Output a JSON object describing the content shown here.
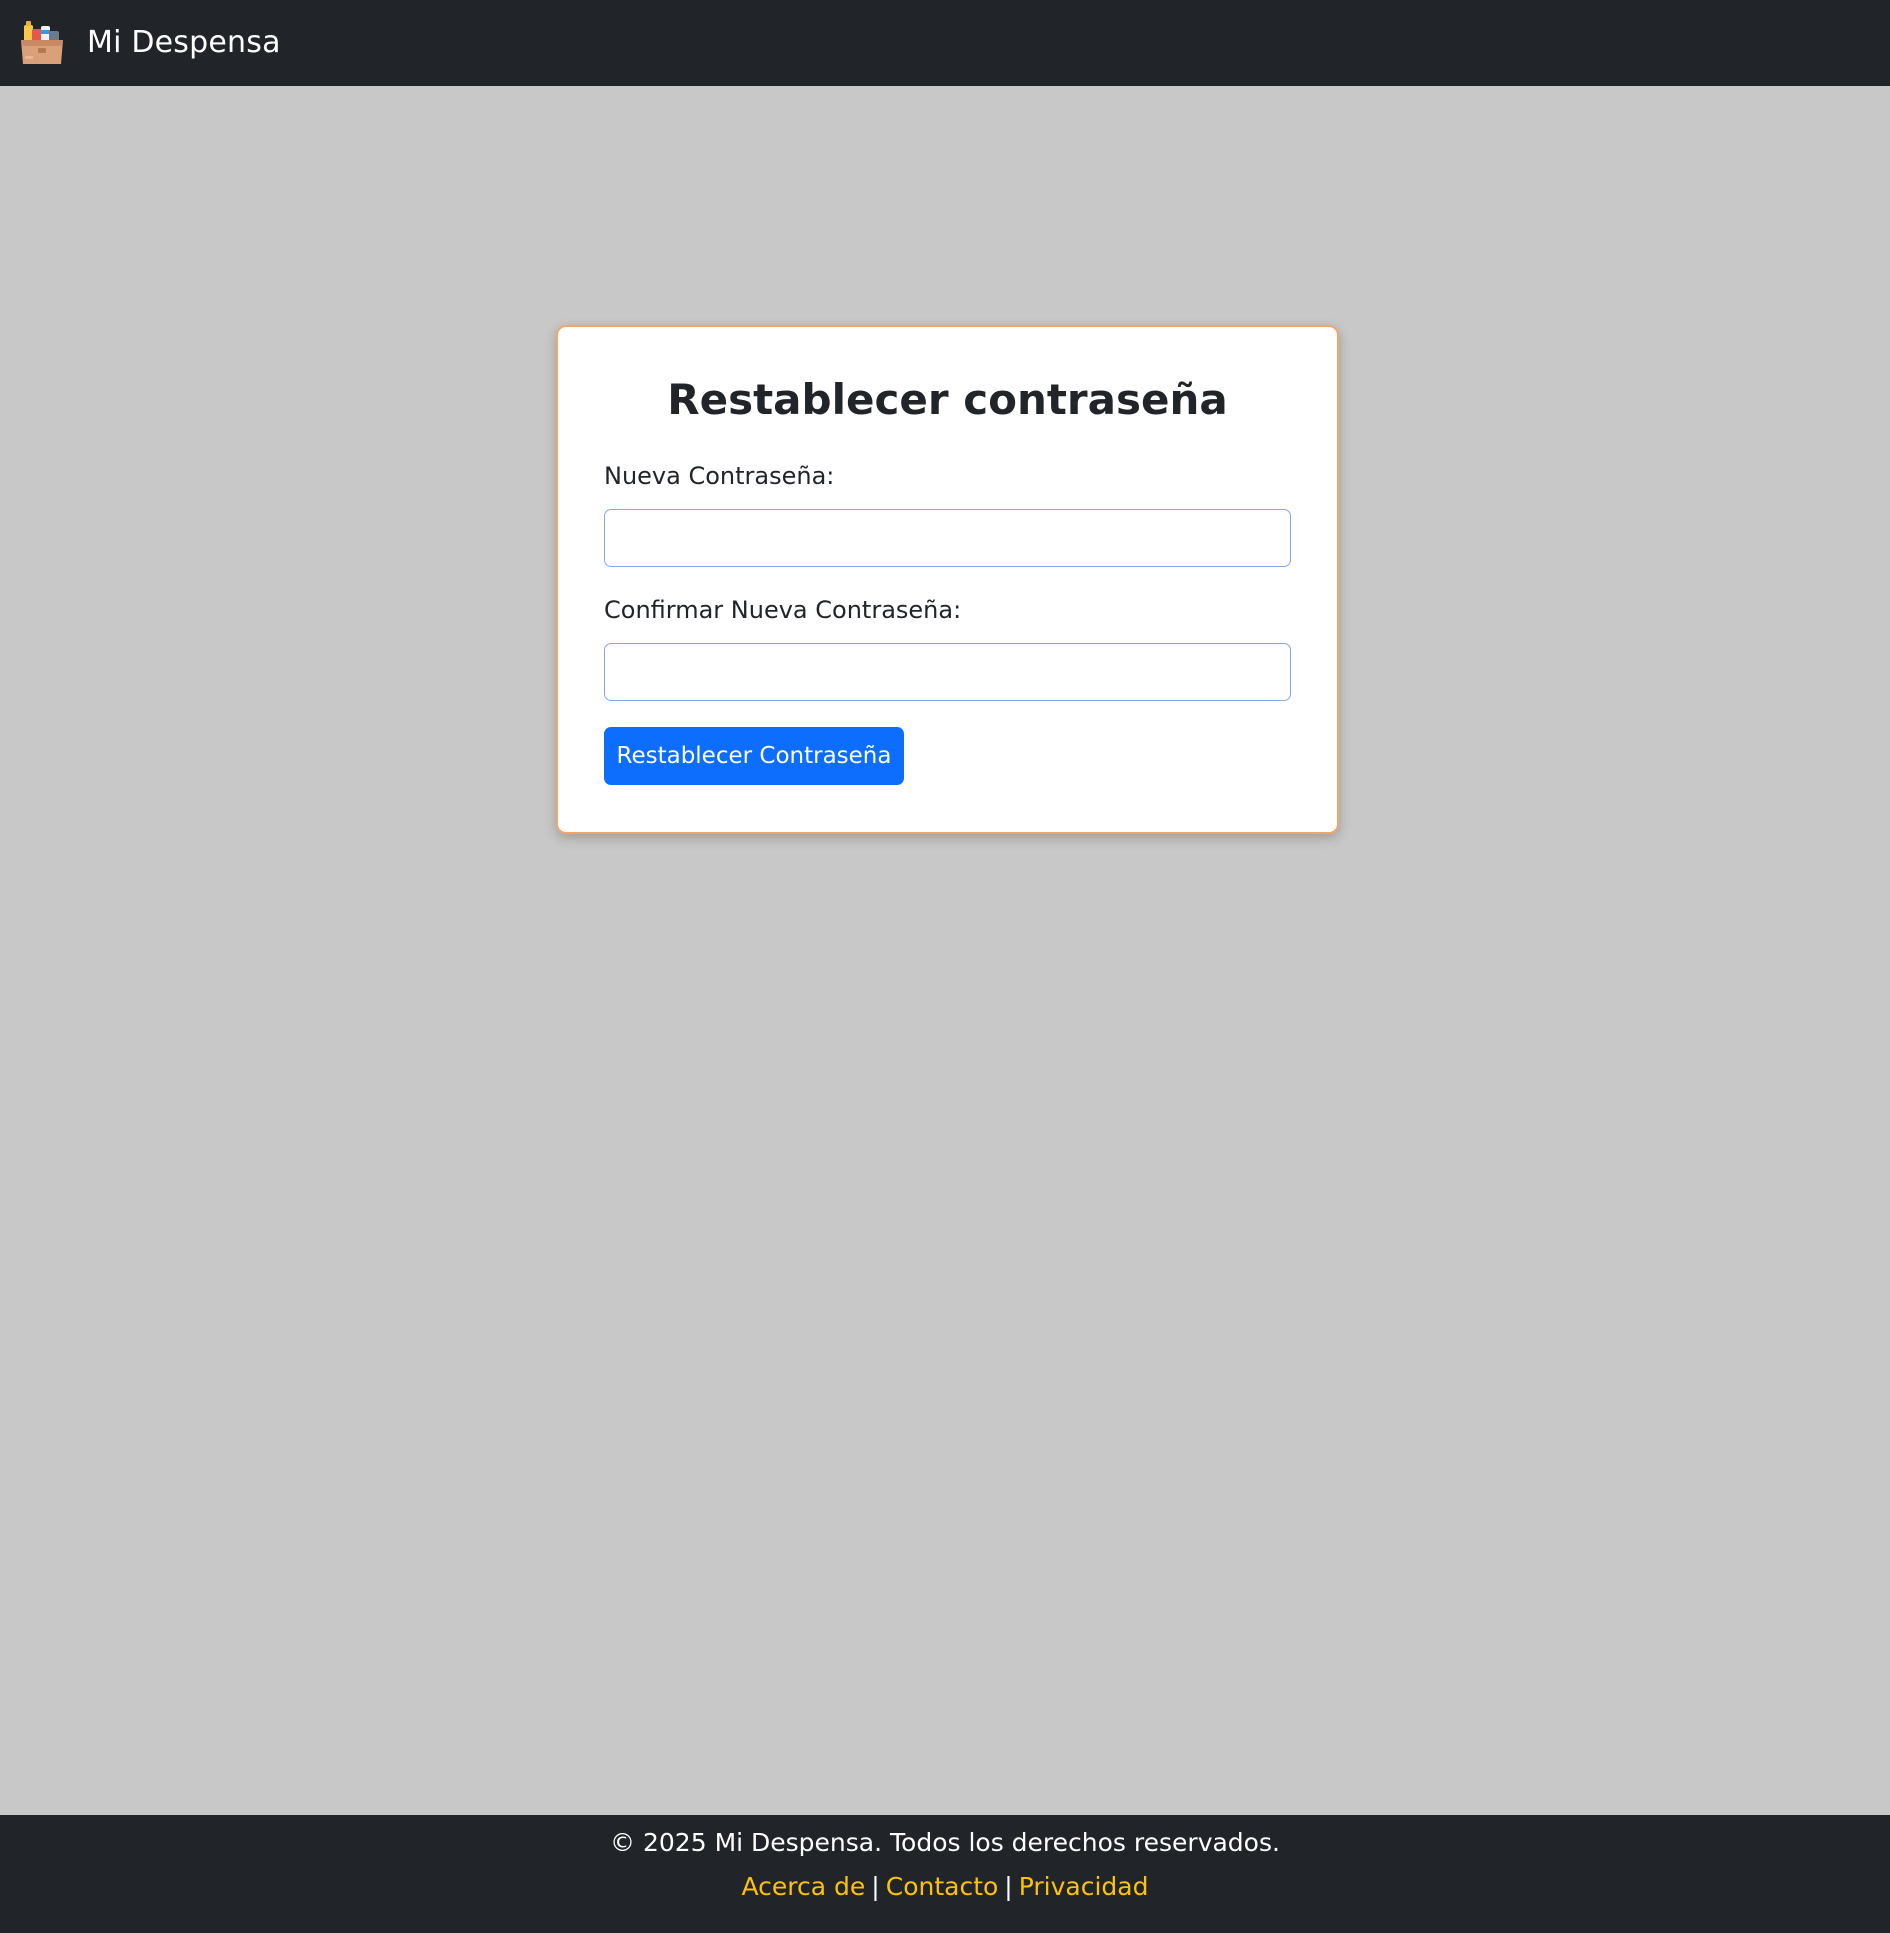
{
  "navbar": {
    "brand_name": "Mi Despensa",
    "logo_icon": "pantry-box-icon"
  },
  "form": {
    "title": "Restablecer contraseña",
    "new_password_label": "Nueva Contraseña:",
    "new_password_value": "",
    "confirm_password_label": "Confirmar Nueva Contraseña:",
    "confirm_password_value": "",
    "submit_label": "Restablecer Contraseña"
  },
  "footer": {
    "copyright": "© 2025 Mi Despensa. Todos los derechos reservados.",
    "links": [
      {
        "label": "Acerca de"
      },
      {
        "label": "Contacto"
      },
      {
        "label": "Privacidad"
      }
    ],
    "separator": "|"
  },
  "colors": {
    "navbar_bg": "#212529",
    "page_bg": "#c8c8c8",
    "card_border": "#f0a868",
    "primary_button": "#0d6efd",
    "footer_link": "#ffc107"
  }
}
